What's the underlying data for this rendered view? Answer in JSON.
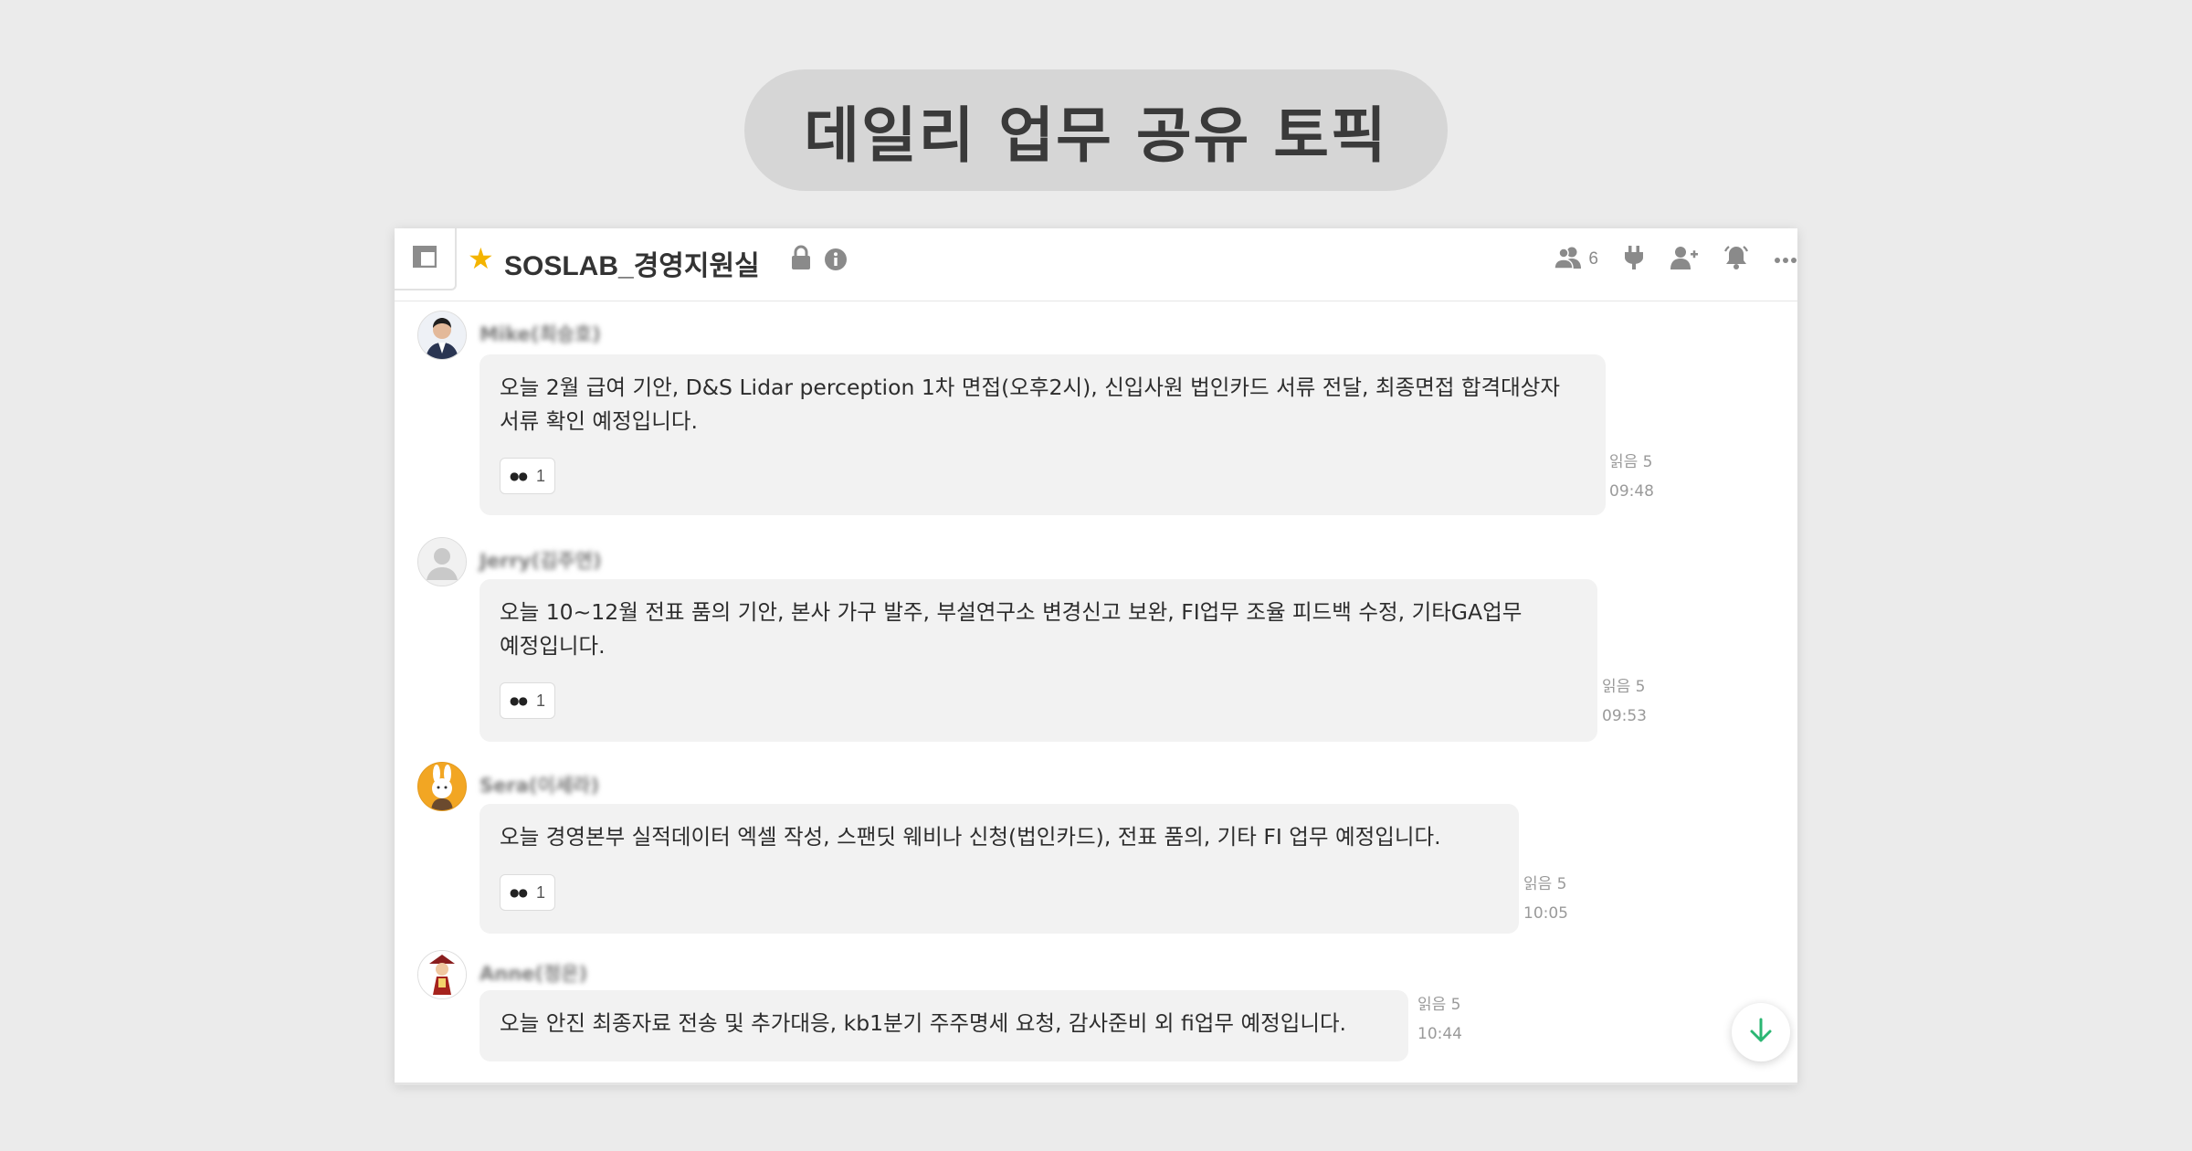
{
  "banner": {
    "title": "데일리 업무 공유 토픽"
  },
  "header": {
    "room_name": "SOSLAB_경영지원실",
    "member_count": "6",
    "icons": [
      "panel-icon",
      "star-icon",
      "lock-icon",
      "info-icon",
      "members-icon",
      "pin-icon",
      "invite-user-icon",
      "bell-icon",
      "more-icon"
    ],
    "star_color": "#f4b400"
  },
  "messages": [
    {
      "sender": "Mike(최승호)",
      "text": "오늘 2월 급여 기안, D&S Lidar perception 1차 면접(오후2시), 신입사원 법인카드 서류 전달, 최종면접 합격대상자\n서류 확인 예정입니다.",
      "reaction_count": "1",
      "read": "읽음 5",
      "time": "09:48"
    },
    {
      "sender": "Jerry(김주연)",
      "text": "오늘 10~12월 전표 품의 기안, 본사 가구 발주, 부설연구소 변경신고 보완, FI업무 조율 피드백 수정, 기타GA업무\n예정입니다.",
      "reaction_count": "1",
      "read": "읽음 5",
      "time": "09:53"
    },
    {
      "sender": "Sera(이세라)",
      "text": "오늘 경영본부 실적데이터 엑셀 작성, 스팬딧 웨비나 신청(법인카드), 전표 품의, 기타 FI 업무 예정입니다.",
      "reaction_count": "1",
      "read": "읽음 5",
      "time": "10:05"
    },
    {
      "sender": "Anne(정은)",
      "text": "오늘 안진 최종자료 전송 및 추가대응, kb1분기 주주명세 요청, 감사준비 외 fi업무 예정입니다.",
      "read": "읽음 5",
      "time": "10:44"
    }
  ],
  "accent_color": "#2bb673"
}
